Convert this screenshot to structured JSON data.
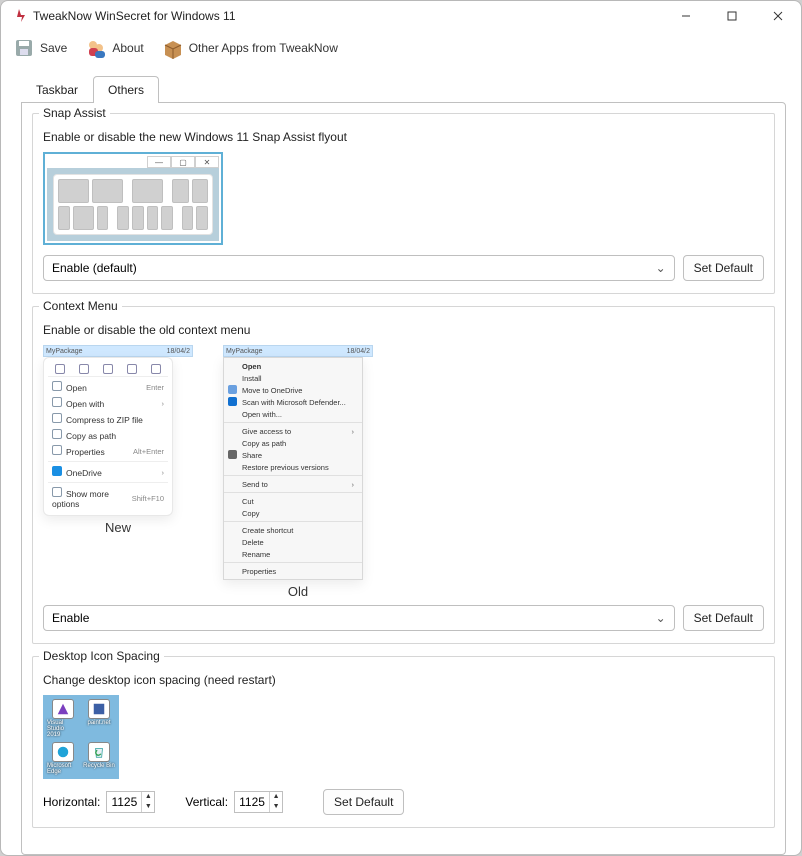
{
  "title": "TweakNow WinSecret for Windows 11",
  "toolbar": {
    "save": "Save",
    "about": "About",
    "otherapps": "Other Apps from TweakNow"
  },
  "tabs": {
    "taskbar": "Taskbar",
    "others": "Others"
  },
  "snap": {
    "title": "Snap Assist",
    "desc": "Enable or disable the new Windows 11 Snap Assist flyout",
    "combo": "Enable (default)",
    "default": "Set Default"
  },
  "cm": {
    "title": "Context Menu",
    "desc": "Enable or disable the old context menu",
    "new_label": "New",
    "old_label": "Old",
    "header_name": "MyPackage",
    "header_date": "18/04/2",
    "combo": "Enable",
    "default": "Set Default",
    "new_menu": {
      "open": "Open",
      "open_hint": "Enter",
      "openwith": "Open with",
      "zip": "Compress to ZIP file",
      "copypath": "Copy as path",
      "props": "Properties",
      "props_hint": "Alt+Enter",
      "onedrive": "OneDrive",
      "more": "Show more options",
      "more_hint": "Shift+F10"
    },
    "old_menu": {
      "open": "Open",
      "install": "Install",
      "move_od": "Move to OneDrive",
      "scan": "Scan with Microsoft Defender...",
      "openwith": "Open with...",
      "give": "Give access to",
      "copypath": "Copy as path",
      "share": "Share",
      "restore": "Restore previous versions",
      "sendto": "Send to",
      "cut": "Cut",
      "copy": "Copy",
      "shortcut": "Create shortcut",
      "delete": "Delete",
      "rename": "Rename",
      "props": "Properties"
    }
  },
  "dis": {
    "title": "Desktop Icon Spacing",
    "desc": "Change desktop icon spacing  (need restart)",
    "icons": {
      "vs": "Visual Studio 2019",
      "pn": "paint.net",
      "edge": "Microsoft Edge",
      "rb": "Recycle Bin"
    },
    "h_label": "Horizontal:",
    "v_label": "Vertical:",
    "h_val": "1125",
    "v_val": "1125",
    "default": "Set Default"
  }
}
